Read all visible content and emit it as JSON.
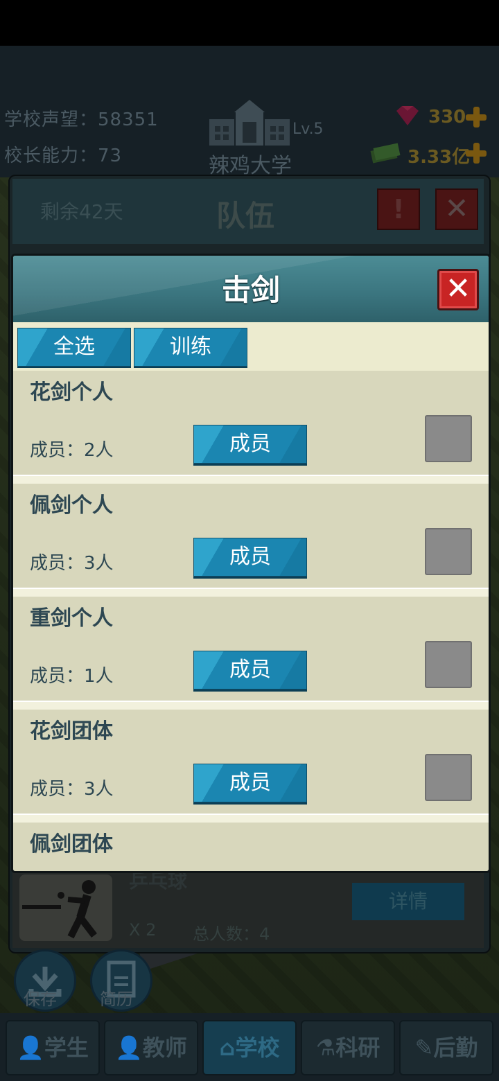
{
  "hud": {
    "reputation_label": "学校声望：",
    "reputation_value": "58351",
    "principal_label": "校长能力：",
    "principal_value": "73",
    "school_name": "辣鸡大学",
    "school_level": "Lv.5",
    "gems": "330",
    "money": "3.33亿"
  },
  "team_panel": {
    "days_left": "剩余42天",
    "title": "队伍",
    "warn_icon": "!",
    "close_icon": "✕",
    "row": {
      "sport": "乒乓球",
      "count": "X 2",
      "total": "总人数：4",
      "detail_button": "详情"
    }
  },
  "float_buttons": [
    {
      "label": "保存",
      "icon": "save-icon"
    },
    {
      "label": "简历",
      "icon": "resume-icon"
    }
  ],
  "dialog": {
    "title": "击剑",
    "close_icon": "✕",
    "toolbar": {
      "select_all": "全选",
      "train": "训练"
    },
    "items": [
      {
        "name": "花剑个人",
        "members": "成员：2人",
        "button": "成员"
      },
      {
        "name": "佩剑个人",
        "members": "成员：3人",
        "button": "成员"
      },
      {
        "name": "重剑个人",
        "members": "成员：1人",
        "button": "成员"
      },
      {
        "name": "花剑团体",
        "members": "成员：3人",
        "button": "成员"
      },
      {
        "name": "佩剑团体",
        "members": "",
        "button": ""
      }
    ]
  },
  "nav": [
    {
      "label": "学生",
      "icon": "student-icon"
    },
    {
      "label": "教师",
      "icon": "teacher-icon"
    },
    {
      "label": "学校",
      "icon": "school-icon"
    },
    {
      "label": "科研",
      "icon": "research-icon"
    },
    {
      "label": "后勤",
      "icon": "logistics-icon"
    }
  ]
}
